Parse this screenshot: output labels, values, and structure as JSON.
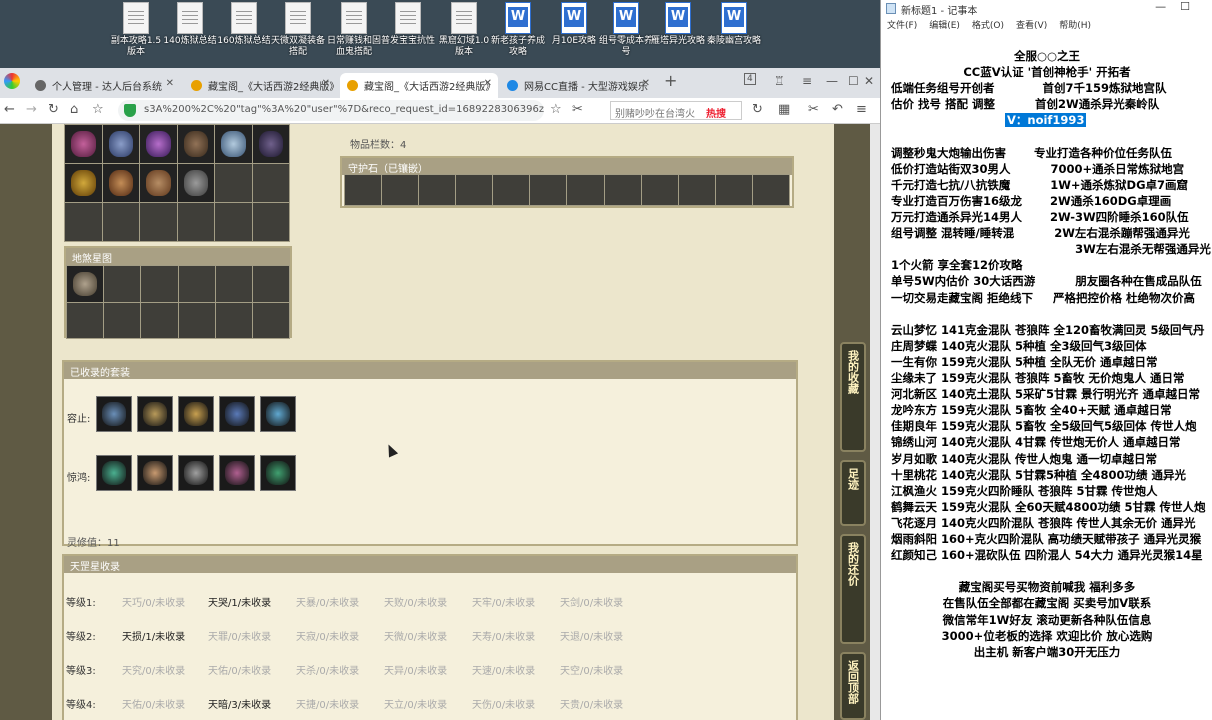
{
  "desktop": {
    "icons": [
      {
        "label": "副本攻略1.5版本",
        "kind": "doc"
      },
      {
        "label": "140炼狱总结",
        "kind": "doc"
      },
      {
        "label": "160炼狱总结",
        "kind": "doc"
      },
      {
        "label": "天微双凝装备搭配",
        "kind": "doc"
      },
      {
        "label": "日常赚钱和固血鬼搭配",
        "kind": "doc"
      },
      {
        "label": "普发宝宝抗性",
        "kind": "doc"
      },
      {
        "label": "黑窟幻域1.0版本",
        "kind": "doc"
      },
      {
        "label": "新老孩子养成攻略",
        "kind": "word"
      },
      {
        "label": "月10E攻略",
        "kind": "word"
      },
      {
        "label": "组号零成本养号",
        "kind": "word"
      },
      {
        "label": "雁塔异光攻略",
        "kind": "word"
      },
      {
        "label": "秦陵幽宫攻略",
        "kind": "word"
      }
    ]
  },
  "browser": {
    "tabs": [
      {
        "label": "个人管理 - 达人后台系统",
        "icon_color": "#666666"
      },
      {
        "label": "藏宝阁_《大话西游2经典版》",
        "icon_color": "#e8a000"
      },
      {
        "label": "藏宝阁_《大话西游2经典版》",
        "icon_color": "#e8a000"
      },
      {
        "label": "网易CC直播 - 大型游戏娱乐",
        "icon_color": "#1e88e5"
      }
    ],
    "tab_count_badge": "4",
    "url": "s3A%200%2C%20\"tag\"%3A%20\"user\"%7D&reco_request_id=1689228306396zd61x",
    "search_placeholder": "别赌吵吵在台湾火",
    "hot_label": "热搜"
  },
  "game": {
    "item_count_label": "物品栏数：4",
    "guardian_stone_header": "守护石（已镶嵌）",
    "earth_palace_header": "地煞星图",
    "collected_suits_header": "已收录的套装",
    "suit_rows": [
      {
        "label": "容止:",
        "colors": [
          "#6a8fb8",
          "#b89a5a",
          "#c8a050",
          "#5a7ab8",
          "#60a8d0"
        ]
      },
      {
        "label": "惊鸿:",
        "colors": [
          "#4ab090",
          "#c89a70",
          "#a0a0a0",
          "#b06090",
          "#40a070"
        ]
      }
    ],
    "spirit_value": "灵修值：11",
    "tiangang_header": "天罡星收录",
    "tiers": [
      {
        "label": "等级1:",
        "entries": [
          {
            "text": "天巧/0/未收录",
            "got": false
          },
          {
            "text": "天哭/1/未收录",
            "got": true
          },
          {
            "text": "天暴/0/未收录",
            "got": false
          },
          {
            "text": "天败/0/未收录",
            "got": false
          },
          {
            "text": "天牢/0/未收录",
            "got": false
          },
          {
            "text": "天剑/0/未收录",
            "got": false
          }
        ]
      },
      {
        "label": "等级2:",
        "entries": [
          {
            "text": "天损/1/未收录",
            "got": true
          },
          {
            "text": "天罪/0/未收录",
            "got": false
          },
          {
            "text": "天寂/0/未收录",
            "got": false
          },
          {
            "text": "天微/0/未收录",
            "got": false
          },
          {
            "text": "天寿/0/未收录",
            "got": false
          },
          {
            "text": "天退/0/未收录",
            "got": false
          }
        ]
      },
      {
        "label": "等级3:",
        "entries": [
          {
            "text": "天究/0/未收录",
            "got": false
          },
          {
            "text": "天佑/0/未收录",
            "got": false
          },
          {
            "text": "天杀/0/未收录",
            "got": false
          },
          {
            "text": "天异/0/未收录",
            "got": false
          },
          {
            "text": "天速/0/未收录",
            "got": false
          },
          {
            "text": "天空/0/未收录",
            "got": false
          }
        ]
      },
      {
        "label": "等级4:",
        "entries": [
          {
            "text": "天佑/0/未收录",
            "got": false
          },
          {
            "text": "天暗/3/未收录",
            "got": true
          },
          {
            "text": "天捷/0/未收录",
            "got": false
          },
          {
            "text": "天立/0/未收录",
            "got": false
          },
          {
            "text": "天伤/0/未收录",
            "got": false
          },
          {
            "text": "天贵/0/未收录",
            "got": false
          }
        ]
      }
    ],
    "side_buttons": [
      "我的收藏",
      "足迹",
      "我的还价",
      "返回顶部"
    ]
  },
  "notepad": {
    "title": "新标题1 - 记事本",
    "menu": [
      "文件(F)",
      "编辑(E)",
      "格式(O)",
      "查看(V)",
      "帮助(H)"
    ],
    "lines": [
      "全服○○之王",
      "CC蓝V认证 '首创神枪手' 开拓者",
      "低端任务组号开创者            首创7千159炼狱地宫队",
      "估价 找号 搭配 调整          首创2W通杀异光秦岭队",
      "V：noif1993",
      "",
      "调整秒鬼大炮输出伤害       专业打造各种价位任务队伍",
      "低价打造站街双30男人          7000+通杀日常炼狱地宫",
      "千元打造七抗/八抗铁魔          1W+通杀炼狱DG卓7画窟",
      "专业打造百万伤害16级龙       2W通杀160DG卓理画",
      "万元打造通杀异光14男人       2W-3W四阶睡杀160队伍",
      "组号调整 混转睡/睡转混          2W左右混杀蹦帮强通异光",
      "                                              3W左右混杀无帮强通异光",
      "1个火箭 享全套12价攻略",
      "单号5W内估价 30大话西游          朋友圈各种在售成品队伍",
      "一切交易走藏宝阁 拒绝线下     严格把控价格 杜绝物次价高",
      "",
      "云山梦忆 141克金混队 苍狼阵 全120畜牧满回灵 5级回气丹",
      "庄周梦蝶 140克火混队 5种植 全3级回气3级回体",
      "一生有你 159克火混队 5种植 全队无价 通卓越日常",
      "尘缘未了 159克火混队 苍狼阵 5畜牧 无价炮鬼人 通日常",
      "河北新区 140克土混队 5采矿5甘霖 景行明光齐 通卓越日常",
      "龙吟东方 159克火混队 5畜牧 全40+天赋 通卓越日常",
      "佳期良年 159克火混队 5畜牧 全5级回气5级回体 传世人炮",
      "锦绣山河 140克火混队 4甘霖 传世炮无价人 通卓越日常",
      "岁月如歌 140克火混队 传世人炮鬼 通一切卓越日常",
      "十里桃花 140克火混队 5甘霖5种植 全4800功绩 通异光",
      "江枫渔火 159克火四阶睡队 苍狼阵 5甘霖 传世炮人",
      "鹤舞云天 159克火混队 全60天赋4800功绩 5甘霖 传世人炮",
      "飞花逐月 140克火四阶混队 苍狼阵 传世人其余无价 通异光",
      "烟雨斜阳 160+克火四阶混队 高功绩天赋带孩子 通异光灵猴",
      "红颜知己 160+混砍队伍 四阶混人 54大力 通异光灵猴14星",
      "",
      "藏宝阁买号买物资前喊我 福利多多",
      "在售队伍全部都在藏宝阁 买卖号加V联系",
      "微信常年1W好友 滚动更新各种队伍信息",
      "3000+位老板的选择 欢迎比价 放心选购",
      "出主机 新客户端30开无压力"
    ]
  }
}
